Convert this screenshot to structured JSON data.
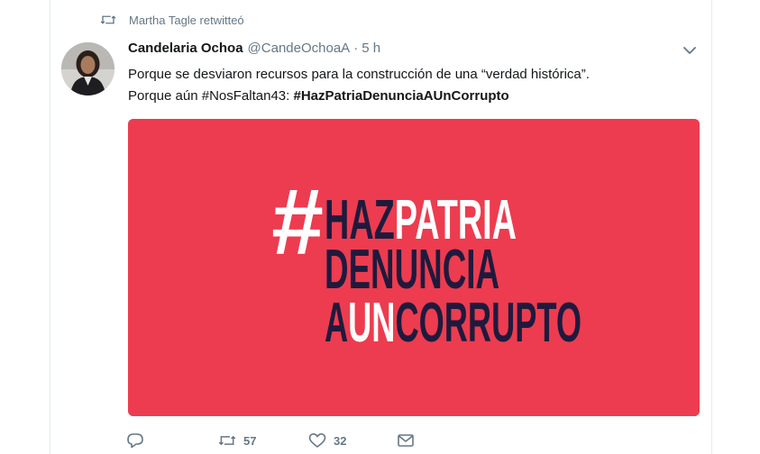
{
  "retweet_context": {
    "text": "Martha Tagle retwitteó"
  },
  "tweet": {
    "author_name": "Candelaria Ochoa",
    "author_handle": "@CandeOchoaA",
    "separator": "·",
    "time": "5 h",
    "text_line1": "Porque se desviaron recursos para la construcción de una “verdad histórica”.",
    "text_line2_prefix": "Porque aún ",
    "hashtag1": "#NosFaltan43",
    "text_line2_mid": ": ",
    "hashtag2": "#HazPatriaDenunciaAUnCorrupto"
  },
  "media": {
    "line1_a": "HAZ",
    "line1_b": "PATRIA",
    "line2": "DENUNCIA",
    "line3_a": "A",
    "line3_b": "UN",
    "line3_c": "CORRUPTO",
    "hash": "#",
    "colors": {
      "background": "#ed3c4f",
      "dark": "#1f1a3d",
      "light": "#ffffff"
    }
  },
  "actions": {
    "reply_count": "",
    "retweet_count": "57",
    "like_count": "32"
  },
  "icons": {
    "retweet": "retweet-icon",
    "chevron": "chevron-down-icon",
    "reply": "reply-icon",
    "like": "heart-icon",
    "dm": "envelope-icon"
  }
}
